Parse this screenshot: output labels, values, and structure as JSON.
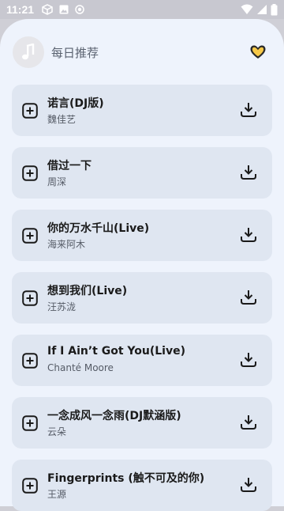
{
  "status_bar": {
    "time": "11:21",
    "icons_left": [
      "cube-icon",
      "image-icon",
      "record-icon"
    ],
    "icons_right": [
      "wifi-icon",
      "signal-icon",
      "battery-icon"
    ]
  },
  "header": {
    "title": "每日推荐",
    "avatar_icon": "music-note-icon",
    "favorite_icon": "heart-icon"
  },
  "songs": [
    {
      "title": "诺言(DJ版)",
      "artist": "魏佳艺"
    },
    {
      "title": "借过一下",
      "artist": "周深"
    },
    {
      "title": "你的万水千山(Live)",
      "artist": "海来阿木"
    },
    {
      "title": "想到我们(Live)",
      "artist": "汪苏泷"
    },
    {
      "title": "If I Ain’t Got You(Live)",
      "artist": "Chanté Moore"
    },
    {
      "title": "一念成风一念雨(DJ默涵版)",
      "artist": "云朵"
    },
    {
      "title": "Fingerprints (触不可及的你)",
      "artist": "王源"
    }
  ],
  "colors": {
    "background": "#eef3fc",
    "card": "#dfe6f1",
    "status_bar": "#c8c8d0",
    "heart_stroke": "#2a2a2a",
    "heart_fill": "#f7c948"
  }
}
